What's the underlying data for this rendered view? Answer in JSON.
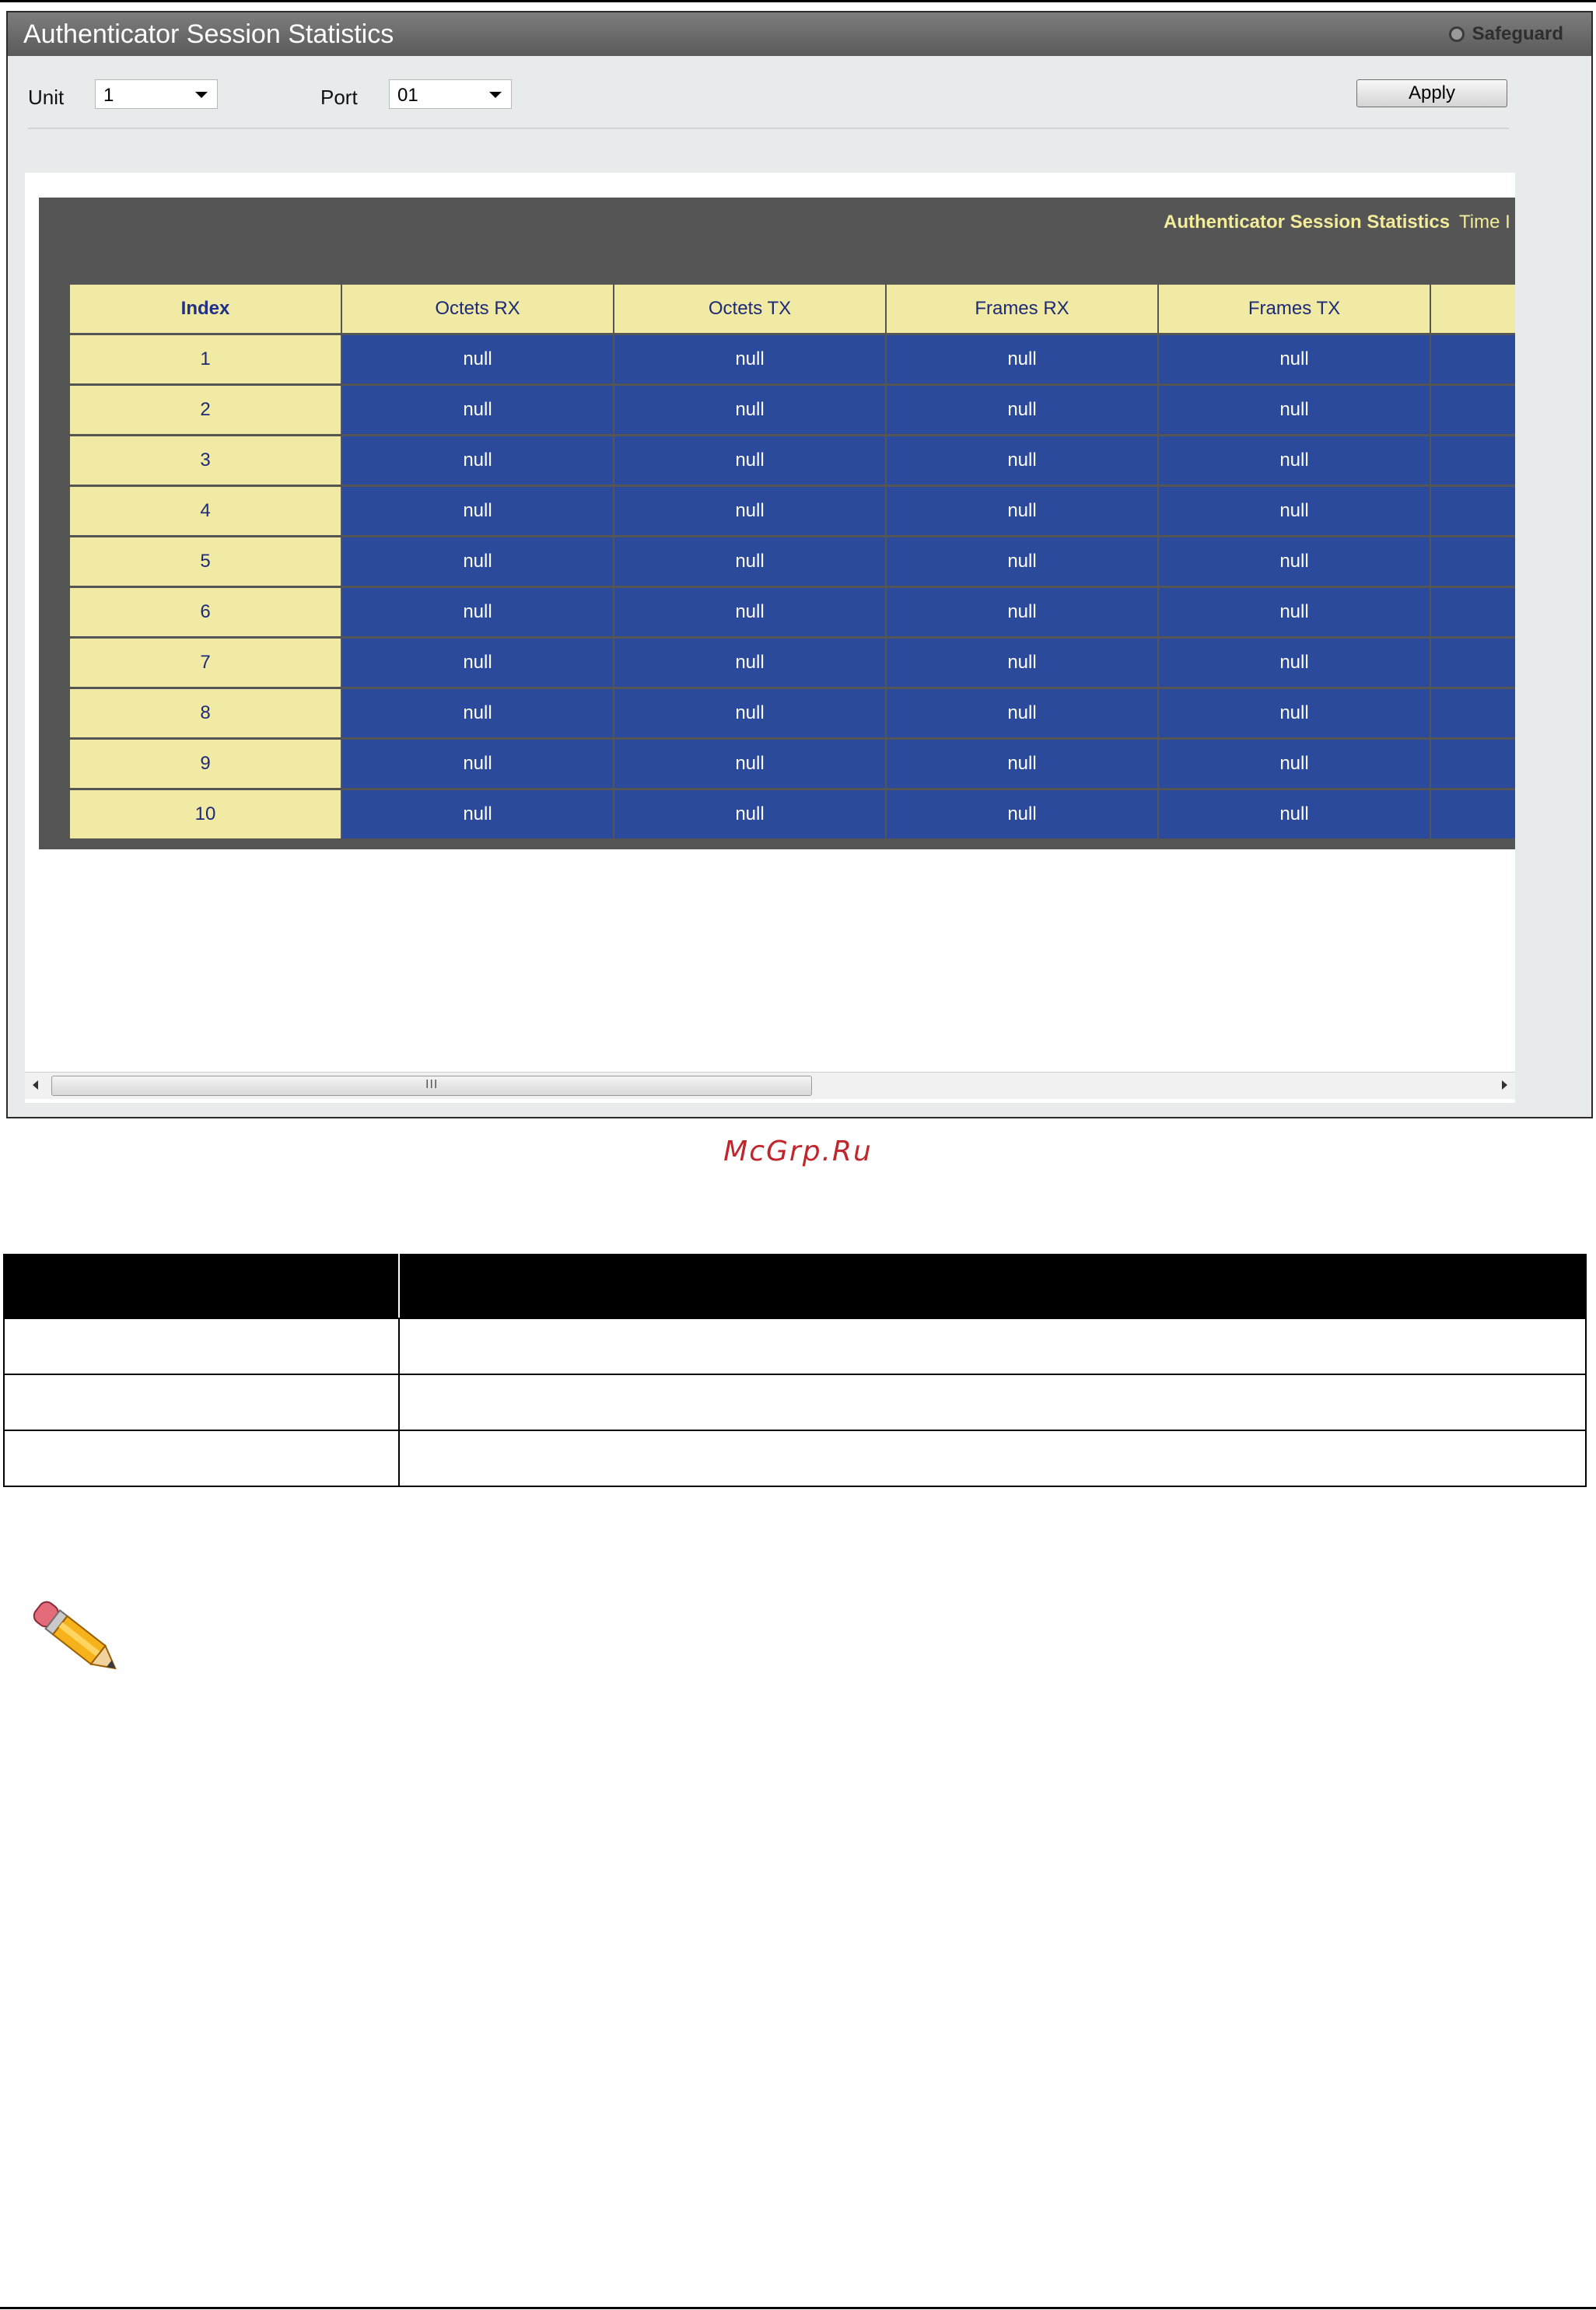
{
  "window": {
    "title": "Authenticator Session Statistics",
    "safeguard_label": "Safeguard"
  },
  "form": {
    "unit_label": "Unit",
    "unit_value": "1",
    "port_label": "Port",
    "port_value": "01",
    "apply_label": "Apply"
  },
  "panel": {
    "title": "Authenticator Session Statistics",
    "time_label": "Time I"
  },
  "table": {
    "columns": [
      "Index",
      "Octets RX",
      "Octets TX",
      "Frames RX",
      "Frames TX"
    ],
    "rows": [
      [
        "1",
        "null",
        "null",
        "null",
        "null"
      ],
      [
        "2",
        "null",
        "null",
        "null",
        "null"
      ],
      [
        "3",
        "null",
        "null",
        "null",
        "null"
      ],
      [
        "4",
        "null",
        "null",
        "null",
        "null"
      ],
      [
        "5",
        "null",
        "null",
        "null",
        "null"
      ],
      [
        "6",
        "null",
        "null",
        "null",
        "null"
      ],
      [
        "7",
        "null",
        "null",
        "null",
        "null"
      ],
      [
        "8",
        "null",
        "null",
        "null",
        "null"
      ],
      [
        "9",
        "null",
        "null",
        "null",
        "null"
      ],
      [
        "10",
        "null",
        "null",
        "null",
        "null"
      ]
    ]
  },
  "scrollbar": {
    "grip": "III"
  },
  "watermark": "McGrp.Ru",
  "icons": {
    "note": "pencil-icon",
    "safeguard": "radio-dot-icon"
  },
  "colors": {
    "header_cell": "#f0eaa4",
    "value_cell": "#2b4a9b",
    "panel_bg": "#555555",
    "panel_title": "#f3ec9a",
    "watermark": "#c0262c"
  }
}
